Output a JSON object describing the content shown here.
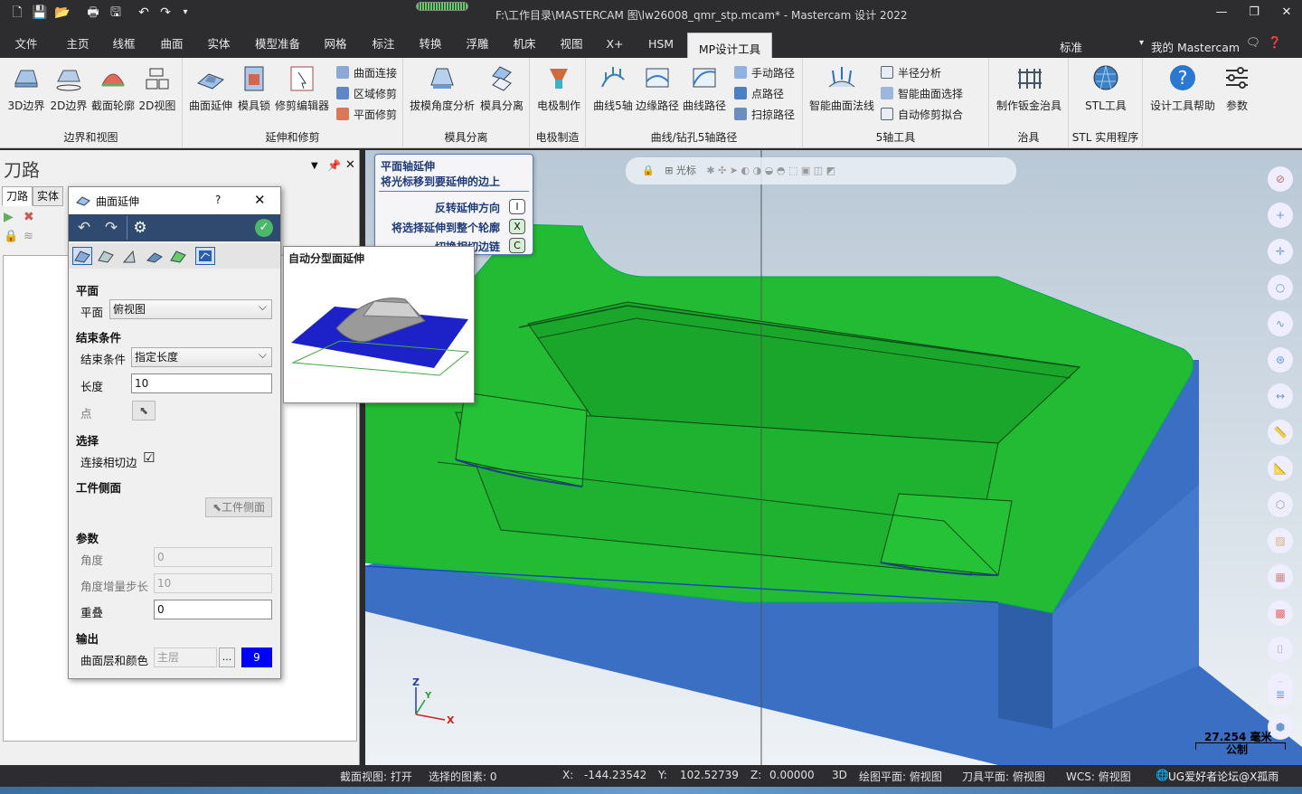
{
  "titlebar": {
    "title": "F:\\工作目录\\MASTERCAM 图\\lw26008_qmr_stp.mcam* - Mastercam 设计 2022"
  },
  "menu": {
    "tabs": [
      "文件",
      "主页",
      "线框",
      "曲面",
      "实体",
      "模型准备",
      "网格",
      "标注",
      "转换",
      "浮雕",
      "机床",
      "视图",
      "X+",
      "HSM",
      "MP设计工具"
    ],
    "active": "MP设计工具",
    "standard": "标准",
    "my_mastercam": "我的 Mastercam"
  },
  "ribbon": {
    "groups": [
      {
        "label": "边界和视图",
        "buttons": [
          "3D边界",
          "2D边界",
          "截面轮廓",
          "2D视图"
        ]
      },
      {
        "label": "延伸和修剪",
        "buttons": [
          "曲面延伸",
          "模具锁",
          "修剪编辑器"
        ],
        "small": [
          "曲面连接",
          "区域修剪",
          "平面修剪"
        ]
      },
      {
        "label": "模具分离",
        "buttons": [
          "拔模角度分析",
          "模具分离"
        ]
      },
      {
        "label": "电极制造",
        "buttons": [
          "电极制作"
        ]
      },
      {
        "label": "曲线/钻孔5轴路径",
        "buttons": [
          "曲线5轴",
          "边缘路径",
          "曲线路径"
        ],
        "small": [
          "手动路径",
          "点路径",
          "扫掠路径"
        ]
      },
      {
        "label": "5轴工具",
        "buttons": [
          "智能曲面法线"
        ],
        "small": [
          "半径分析",
          "智能曲面选择",
          "自动修剪拟合"
        ]
      },
      {
        "label": "治具",
        "buttons": [
          "制作钣金治具"
        ]
      },
      {
        "label": "STL 实用程序",
        "buttons": [
          "STL工具"
        ]
      },
      {
        "label": "",
        "buttons": [
          "设计工具帮助",
          "参数"
        ]
      }
    ]
  },
  "left_panel": {
    "title": "刀路",
    "tabs": [
      "刀路",
      "实体"
    ]
  },
  "dialog": {
    "title": "曲面延伸",
    "help": "?",
    "sections": {
      "plane": {
        "heading": "平面",
        "label": "平面",
        "value": "俯视图"
      },
      "end": {
        "heading": "结束条件",
        "label": "结束条件",
        "value": "指定长度",
        "length_label": "长度",
        "length_value": "10",
        "point_label": "点"
      },
      "select": {
        "heading": "选择",
        "chain_label": "连接相切边",
        "chain_checked": "☑"
      },
      "side": {
        "heading": "工件侧面",
        "button": "工件侧面"
      },
      "params": {
        "heading": "参数",
        "angle_label": "角度",
        "angle_value": "0",
        "step_label": "角度增量步长",
        "step_value": "10",
        "overlap_label": "重叠",
        "overlap_value": "0"
      },
      "output": {
        "heading": "输出",
        "layer_label": "曲面层和颜色",
        "layer_placeholder": "主层",
        "dots": "...",
        "color_value": "9"
      }
    }
  },
  "preview": {
    "title": "自动分型面延伸"
  },
  "hint": {
    "line1": "平面轴延伸",
    "line2": "将光标移到要延伸的边上",
    "options": [
      {
        "label": "反转延伸方向",
        "key": "I"
      },
      {
        "label": "将选择延伸到整个轮廓",
        "key": "X"
      },
      {
        "label": "切换相切边链",
        "key": "C"
      }
    ]
  },
  "viewport": {
    "cursor_label": "光标",
    "scale_value": "27.254 毫米",
    "scale_unit": "公制",
    "axes": {
      "x": "X",
      "y": "Y",
      "z": "Z"
    }
  },
  "status": {
    "section_view": "截面视图: 打开",
    "selected": "选择的图素: 0",
    "x_label": "X:",
    "x_value": "-144.23542",
    "y_label": "Y:",
    "y_value": "102.52739",
    "z_label": "Z:",
    "z_value": "0.00000",
    "mode": "3D",
    "draw_plane": "绘图平面: 俯视图",
    "tool_plane": "刀具平面: 俯视图",
    "wcs": "WCS: 俯视图",
    "watermark": "UG爱好者论坛@X孤雨"
  },
  "colors": {
    "model_green": "#22bb33",
    "model_blue": "#3a6fc4",
    "dark_chrome": "#2d2d30",
    "dialog_toolbar": "#2f4a6e",
    "color_swatch": "#0000ff"
  }
}
